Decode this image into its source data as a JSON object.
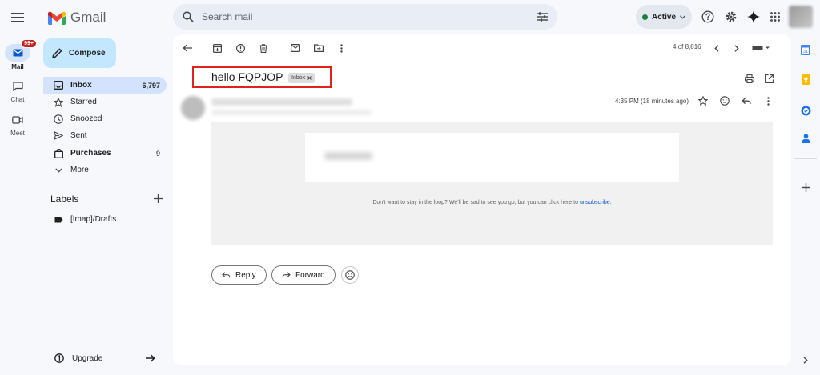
{
  "app": {
    "name": "Gmail"
  },
  "search": {
    "placeholder": "Search mail"
  },
  "status": {
    "label": "Active",
    "color": "#188038"
  },
  "rail": {
    "mail": {
      "label": "Mail",
      "badge": "99+"
    },
    "chat": {
      "label": "Chat"
    },
    "meet": {
      "label": "Meet"
    }
  },
  "sidebar": {
    "compose_label": "Compose",
    "items": [
      {
        "label": "Inbox",
        "count": "6,797",
        "icon": "inbox-icon",
        "active": true
      },
      {
        "label": "Starred",
        "count": "",
        "icon": "star-icon"
      },
      {
        "label": "Snoozed",
        "count": "",
        "icon": "clock-icon"
      },
      {
        "label": "Sent",
        "count": "",
        "icon": "send-icon"
      },
      {
        "label": "Purchases",
        "count": "9",
        "icon": "bag-icon",
        "bold": true
      },
      {
        "label": "More",
        "count": "",
        "icon": "chevron-down-icon"
      }
    ],
    "labels_title": "Labels",
    "labels": [
      {
        "label": "[Imap]/Drafts",
        "icon": "label-icon"
      }
    ],
    "upgrade_label": "Upgrade"
  },
  "toolbar": {
    "pager": "4 of 8,816"
  },
  "message": {
    "subject": "hello FQPJOP",
    "chip": "Inbox",
    "timestamp": "4:35 PM (18 minutes ago)",
    "footer_text": "Don't want to stay in the loop? We'll be sad to see you go, but you can click here to",
    "footer_link": "unsubscribe",
    "footer_end": ".",
    "reply_label": "Reply",
    "forward_label": "Forward"
  },
  "colors": {
    "compose_bg": "#c2e7ff",
    "active_nav": "#d3e3fd",
    "link": "#0b57d0",
    "highlight_border": "#e2221a",
    "badge": "#c5221f"
  }
}
